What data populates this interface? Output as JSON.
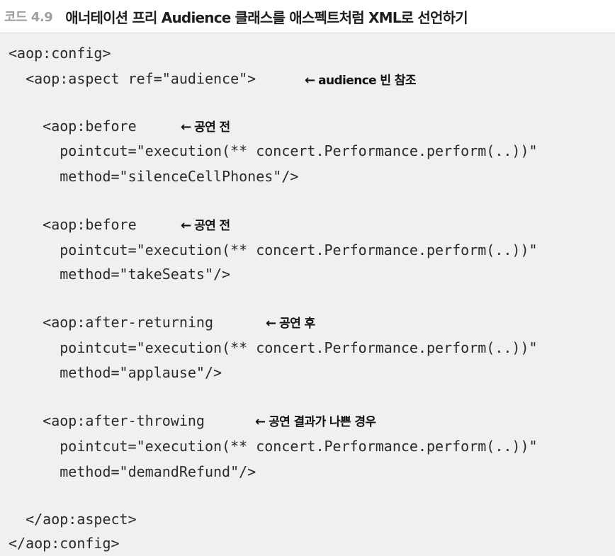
{
  "header": {
    "code_number": "코드 4.9",
    "title": "애너테이션 프리 Audience 클래스를 애스펙트처럼 XML로 선언하기"
  },
  "code": {
    "l1": "<aop:config>",
    "l2": "  <aop:aspect ref=\"audience\">",
    "l3": "    <aop:before",
    "l4": "      pointcut=\"execution(** concert.Performance.perform(..))\"",
    "l5": "      method=\"silenceCellPhones\"/>",
    "l6": "    <aop:before",
    "l7": "      pointcut=\"execution(** concert.Performance.perform(..))\"",
    "l8": "      method=\"takeSeats\"/>",
    "l9": "    <aop:after-returning",
    "l10": "      pointcut=\"execution(** concert.Performance.perform(..))\"",
    "l11": "      method=\"applause\"/>",
    "l12": "    <aop:after-throwing",
    "l13": "      pointcut=\"execution(** concert.Performance.perform(..))\"",
    "l14": "      method=\"demandRefund\"/>",
    "l15": "  </aop:aspect>",
    "l16": "</aop:config>"
  },
  "annotations": {
    "arrow": "←",
    "a1": "audience 빈 참조",
    "a2": "공연 전",
    "a3": "공연 전",
    "a4": "공연 후",
    "a5": "공연 결과가 나쁜 경우"
  }
}
